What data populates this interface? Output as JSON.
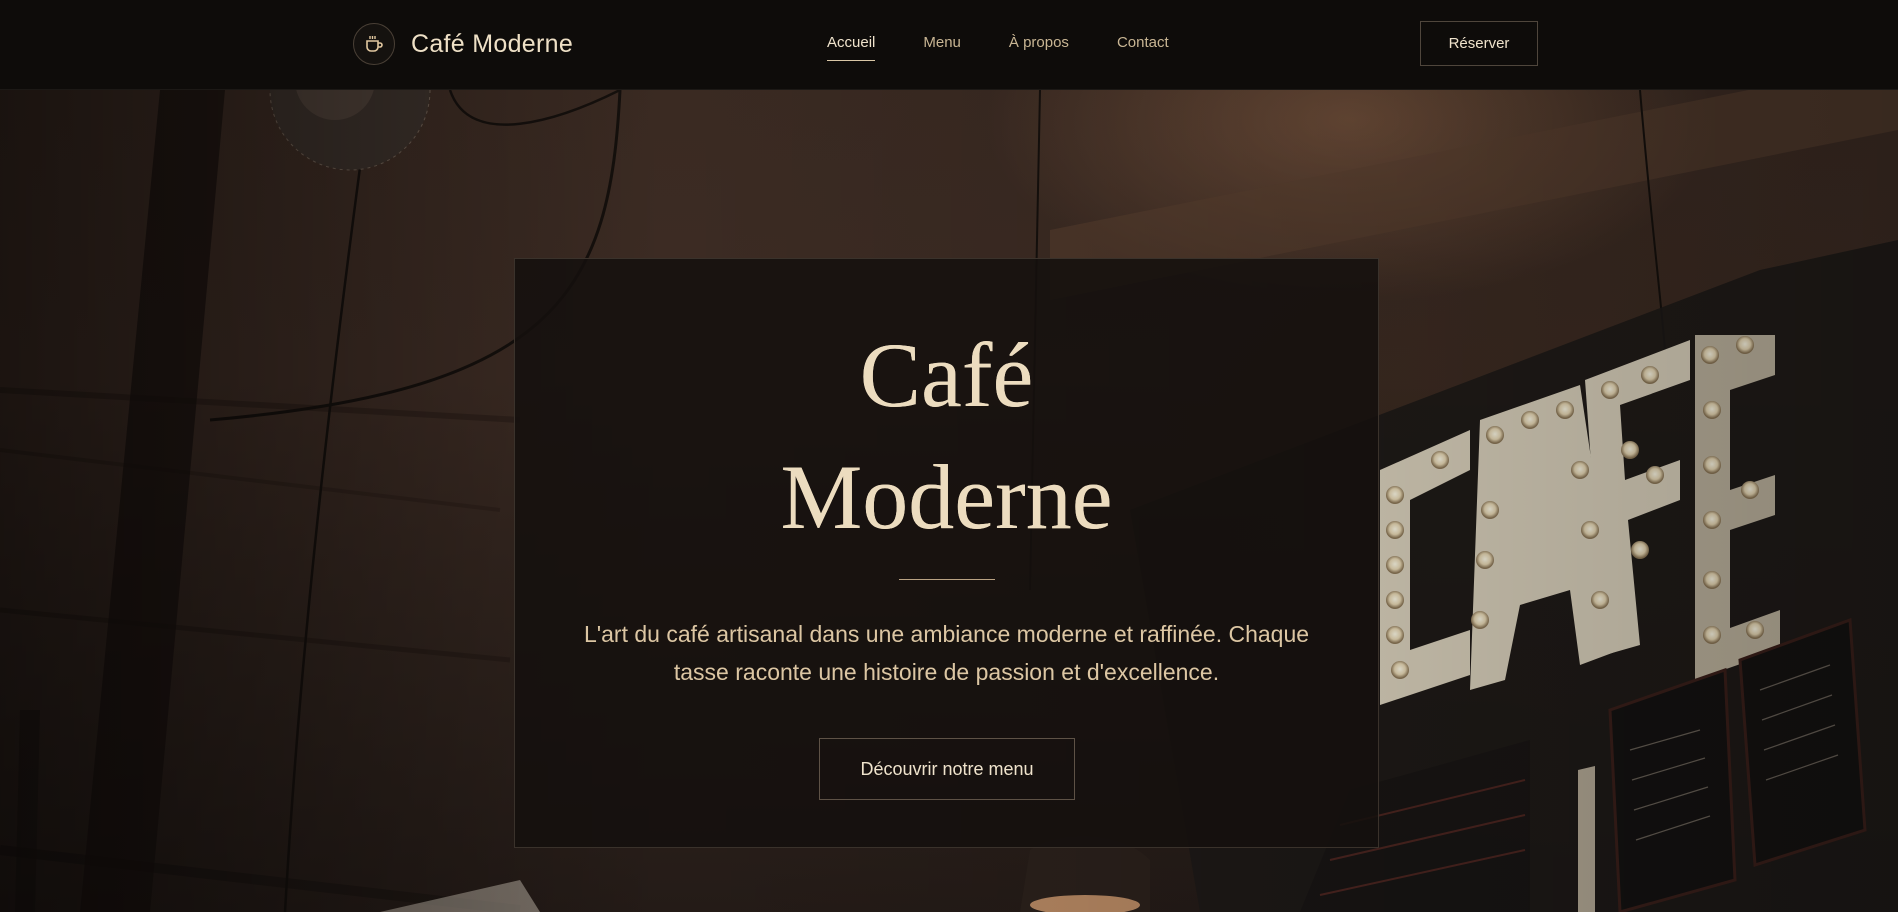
{
  "brand": {
    "name": "Café Moderne",
    "logo_icon": "coffee-cup-icon"
  },
  "nav": {
    "items": [
      {
        "label": "Accueil",
        "active": true
      },
      {
        "label": "Menu",
        "active": false
      },
      {
        "label": "À propos",
        "active": false
      },
      {
        "label": "Contact",
        "active": false
      }
    ]
  },
  "header": {
    "reserve_label": "Réserver"
  },
  "hero": {
    "title_line1": "Café",
    "title_line2": "Moderne",
    "description": "L'art du café artisanal dans une ambiance moderne et raffinée. Chaque tasse raconte une histoire de passion et d'excellence.",
    "cta_label": "Découvrir notre menu"
  },
  "colors": {
    "background": "#0e0c0a",
    "accent": "#e2c8a0",
    "text_light": "#efe3cc",
    "border": "#4f463c"
  }
}
